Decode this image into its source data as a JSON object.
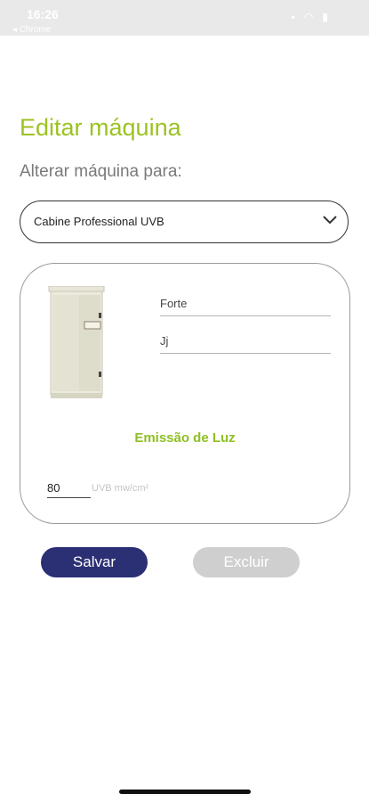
{
  "status_bar": {
    "time": "16:26",
    "back_label": "◂ Chrome"
  },
  "header": {
    "title": "Editar máquina",
    "subtitle": "Alterar máquina para:"
  },
  "machine_select": {
    "selected": "Cabine Professional UVB"
  },
  "card": {
    "name_value": "Forte",
    "description_value": "Jj",
    "section_title": "Emissão de Luz",
    "emission_value": "80",
    "emission_unit": "UVB mw/cm²"
  },
  "actions": {
    "save_label": "Salvar",
    "delete_label": "Excluir"
  },
  "colors": {
    "accent": "#9cc222",
    "primary_button": "#2b2f74",
    "disabled_button": "#cfcfcf"
  }
}
